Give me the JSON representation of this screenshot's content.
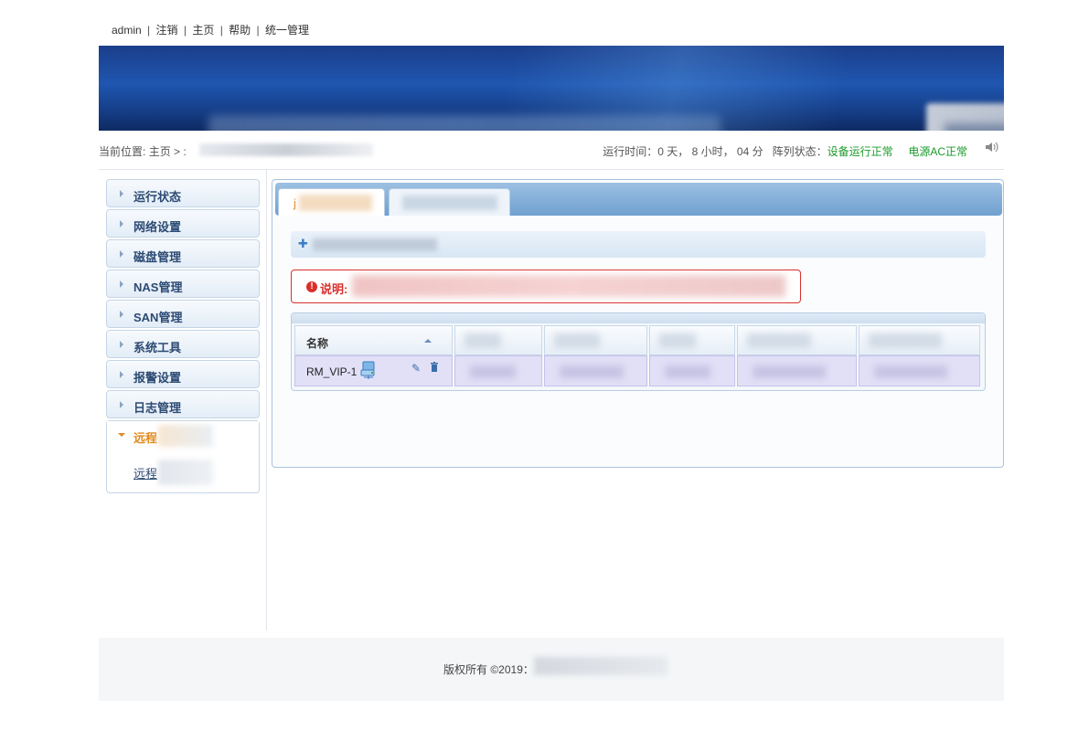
{
  "top_links": {
    "user": "admin",
    "separator": "|",
    "logout": "注销",
    "home": "主页",
    "help": "帮助",
    "unified": "统一管理"
  },
  "location": {
    "prefix": "当前位置:",
    "home": "主页",
    "arrow": ">",
    "current": ":"
  },
  "status": {
    "runtime_label": "运行时间：",
    "runtime_value": "0 天， 8 小时， 04 分",
    "array_label": "阵列状态：",
    "array_value": "设备运行正常",
    "power_value": "电源AC正常",
    "ok_color": "#1a9a2a"
  },
  "sidebar": {
    "items": [
      {
        "label": "运行状态"
      },
      {
        "label": "网络设置"
      },
      {
        "label": "磁盘管理"
      },
      {
        "label": "NAS管理"
      },
      {
        "label": "SAN管理"
      },
      {
        "label": "系统工具"
      },
      {
        "label": "报警设置"
      },
      {
        "label": "日志管理"
      }
    ],
    "open_group": {
      "label": "远程",
      "sub_label": "远程"
    },
    "active_color": "#e08a1e"
  },
  "tabs": {
    "active_label": "j"
  },
  "toolbar": {
    "add_icon": "plus-icon",
    "add_label": ""
  },
  "notice": {
    "icon": "info-circle-icon",
    "label": "说明:"
  },
  "table": {
    "header_name": "名称",
    "rows": [
      {
        "name": "RM_VIP-1"
      }
    ]
  },
  "footer": {
    "copyright": "版权所有 ©2019："
  }
}
